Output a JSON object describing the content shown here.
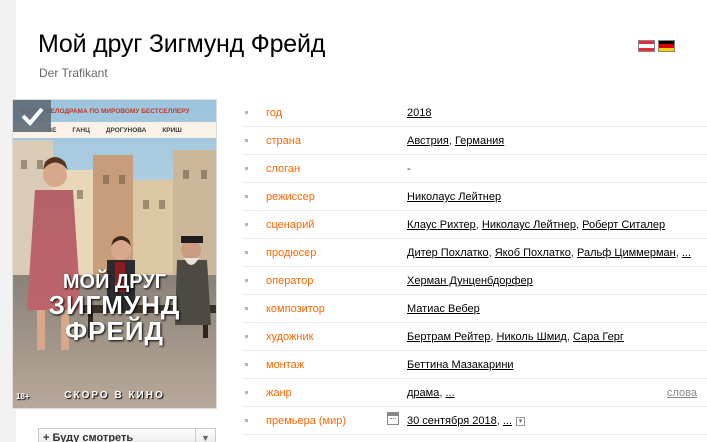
{
  "film": {
    "title": "Мой друг Зигмунд Фрейд",
    "original_title": "Der Trafikant"
  },
  "flags": [
    {
      "name": "Austria",
      "colors": [
        "#ed2939",
        "#ffffff",
        "#ed2939"
      ]
    },
    {
      "name": "Germany",
      "colors": [
        "#000000",
        "#dd0000",
        "#ffce00"
      ]
    }
  ],
  "poster": {
    "top_text": "ЕСКАЯ МЕЛОДРАМА ПО МИРОВОМУ БЕСТСЕЛЛЕРУ",
    "actors": [
      "ЗЕ",
      "ГАНЦ",
      "ДРОГУНОВА",
      "КРИШ"
    ],
    "title_line1": "МОЙ ДРУГ",
    "title_line2": "ЗИГМУНД",
    "title_line3": "ФРЕЙД",
    "coming": "СКОРО В КИНО",
    "age": "18+"
  },
  "watch_button": {
    "label": "+ Буду смотреть",
    "arrow": "▼"
  },
  "info": {
    "year": {
      "label": "год",
      "value": "2018"
    },
    "country": {
      "label": "страна",
      "values": [
        "Австрия",
        "Германия"
      ]
    },
    "slogan": {
      "label": "слоган",
      "value": "-"
    },
    "director": {
      "label": "режиссер",
      "values": [
        "Николаус Лейтнер"
      ]
    },
    "writer": {
      "label": "сценарий",
      "values": [
        "Клаус Рихтер",
        "Николаус Лейтнер",
        "Роберт Ситалер"
      ]
    },
    "producer": {
      "label": "продюсер",
      "values": [
        "Дитер Похлатко",
        "Якоб Похлатко",
        "Ральф Циммерман",
        "..."
      ]
    },
    "operator": {
      "label": "оператор",
      "values": [
        "Херман Дунценбдорфер"
      ]
    },
    "composer": {
      "label": "композитор",
      "values": [
        "Матиас Вебер"
      ]
    },
    "artist": {
      "label": "художник",
      "values": [
        "Бертрам Рейтер",
        "Николь Шмид",
        "Сара Герг"
      ]
    },
    "editing": {
      "label": "монтаж",
      "values": [
        "Беттина Мазакарини"
      ]
    },
    "genre": {
      "label": "жанр",
      "values": [
        "драма",
        "..."
      ],
      "extra": "слова"
    },
    "premiere": {
      "label": "премьера (мир)",
      "values": [
        "30 сентября 2018",
        "..."
      ]
    }
  }
}
